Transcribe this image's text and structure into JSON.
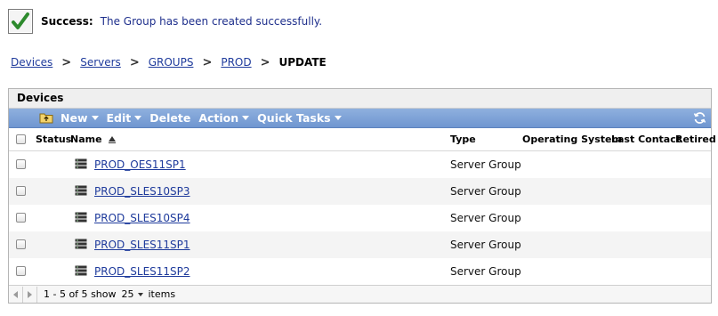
{
  "status": {
    "label": "Success:",
    "message": "The Group has been created successfully.",
    "icon": "checkmark-icon",
    "color": "#2d8a2d"
  },
  "breadcrumb": {
    "items": [
      "Devices",
      "Servers",
      "GROUPS",
      "PROD"
    ],
    "current": "UPDATE",
    "separator": ">"
  },
  "panel": {
    "title": "Devices",
    "toolbar": {
      "new": "New",
      "edit": "Edit",
      "delete": "Delete",
      "action": "Action",
      "quick_tasks": "Quick Tasks"
    },
    "columns": {
      "status": "Status",
      "name": "Name",
      "type": "Type",
      "os": "Operating System",
      "last_contact": "Last Contact",
      "retired": "Retired"
    },
    "rows": [
      {
        "name": "PROD_OES11SP1",
        "type": "Server Group"
      },
      {
        "name": "PROD_SLES10SP3",
        "type": "Server Group"
      },
      {
        "name": "PROD_SLES10SP4",
        "type": "Server Group"
      },
      {
        "name": "PROD_SLES11SP1",
        "type": "Server Group"
      },
      {
        "name": "PROD_SLES11SP2",
        "type": "Server Group"
      }
    ],
    "pager": {
      "range": "1 - 5 of 5",
      "show_label": "show",
      "page_size": "25",
      "items_label": "items"
    }
  },
  "colors": {
    "toolbar_bg": "#7aa0d6",
    "link": "#1f3b9c",
    "message": "#1e2f8c"
  }
}
